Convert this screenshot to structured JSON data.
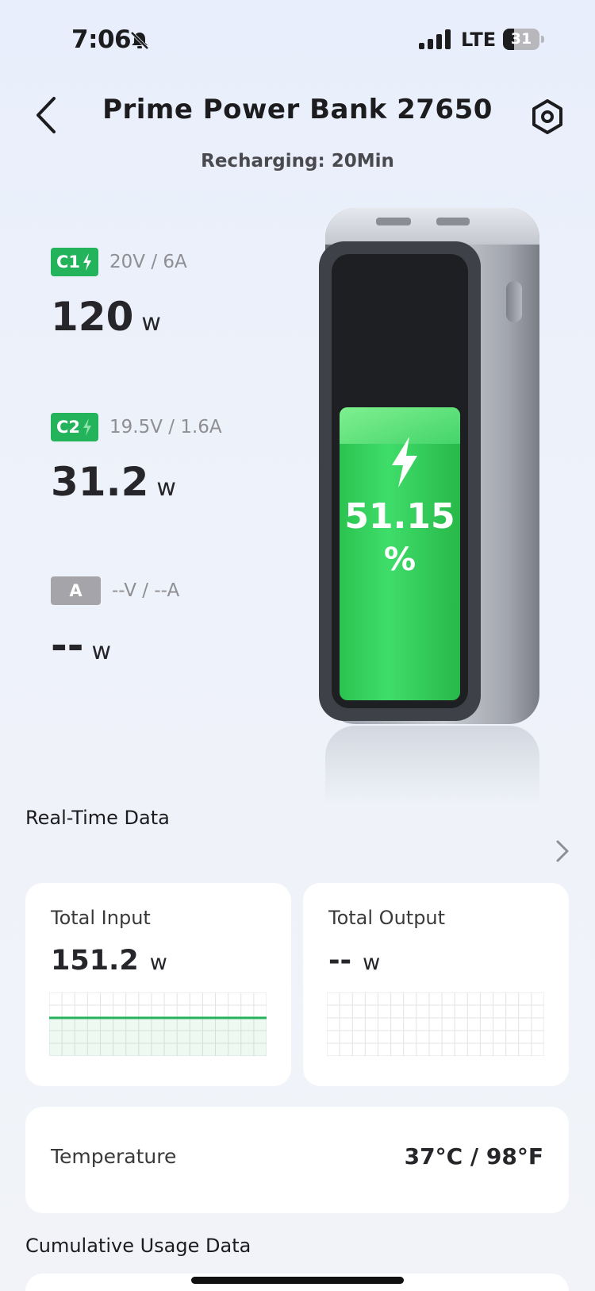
{
  "status_bar": {
    "time": "7:06",
    "network": "LTE",
    "battery": "31",
    "battery_level": 0.31
  },
  "header": {
    "title": "Prime Power Bank 27650",
    "subtitle": "Recharging: 20Min"
  },
  "ports": [
    {
      "badge": "C1",
      "spec": "20V / 6A",
      "power": "120",
      "unit": "w",
      "active": true
    },
    {
      "badge": "C2",
      "spec": "19.5V / 1.6A",
      "power": "31.2",
      "unit": "w",
      "active": true
    },
    {
      "badge": "A",
      "spec": "--V / --A",
      "power": "--",
      "unit": "w",
      "active": false
    }
  ],
  "device": {
    "charge_value": "51.15",
    "charge_unit": "%",
    "charge_level": 0.5115,
    "fill_color": "#2bc350"
  },
  "realtime": {
    "title": "Real-Time Data",
    "total_input": {
      "label": "Total Input",
      "value": "151.2",
      "unit": "w",
      "line_level": 0.6,
      "line_color": "#23b35a"
    },
    "total_output": {
      "label": "Total Output",
      "value": "--",
      "unit": "w"
    },
    "temperature": {
      "label": "Temperature",
      "value": "37°C / 98°F"
    }
  },
  "cumulative": {
    "title": "Cumulative Usage Data"
  },
  "colors": {
    "accent": "#23b35a",
    "inactive": "#a5a5a9"
  }
}
